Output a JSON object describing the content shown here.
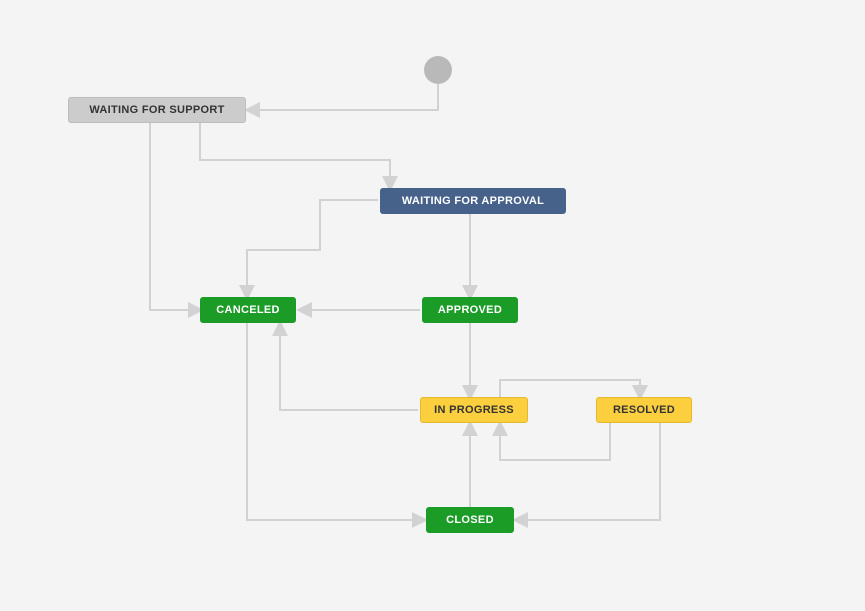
{
  "nodes": {
    "waiting_for_support": {
      "label": "WAITING FOR SUPPORT",
      "color": "gray"
    },
    "waiting_for_approval": {
      "label": "WAITING FOR APPROVAL",
      "color": "blue"
    },
    "canceled": {
      "label": "CANCELED",
      "color": "green"
    },
    "approved": {
      "label": "APPROVED",
      "color": "green"
    },
    "in_progress": {
      "label": "IN PROGRESS",
      "color": "yellow"
    },
    "resolved": {
      "label": "RESOLVED",
      "color": "yellow"
    },
    "closed": {
      "label": "CLOSED",
      "color": "green"
    }
  },
  "transitions": [
    {
      "from": "start",
      "to": "waiting_for_support"
    },
    {
      "from": "waiting_for_support",
      "to": "waiting_for_approval"
    },
    {
      "from": "waiting_for_support",
      "to": "canceled"
    },
    {
      "from": "waiting_for_approval",
      "to": "approved"
    },
    {
      "from": "waiting_for_approval",
      "to": "canceled"
    },
    {
      "from": "approved",
      "to": "in_progress"
    },
    {
      "from": "approved",
      "to": "canceled"
    },
    {
      "from": "in_progress",
      "to": "resolved"
    },
    {
      "from": "in_progress",
      "to": "canceled"
    },
    {
      "from": "resolved",
      "to": "in_progress"
    },
    {
      "from": "resolved",
      "to": "closed"
    },
    {
      "from": "canceled",
      "to": "closed"
    },
    {
      "from": "closed",
      "to": "in_progress"
    }
  ],
  "colors": {
    "arrow": "#d2d2d2",
    "node_gray_bg": "#cccccc",
    "node_blue_bg": "#46628a",
    "node_green_bg": "#1a9c27",
    "node_yellow_bg": "#fbcf3e"
  }
}
